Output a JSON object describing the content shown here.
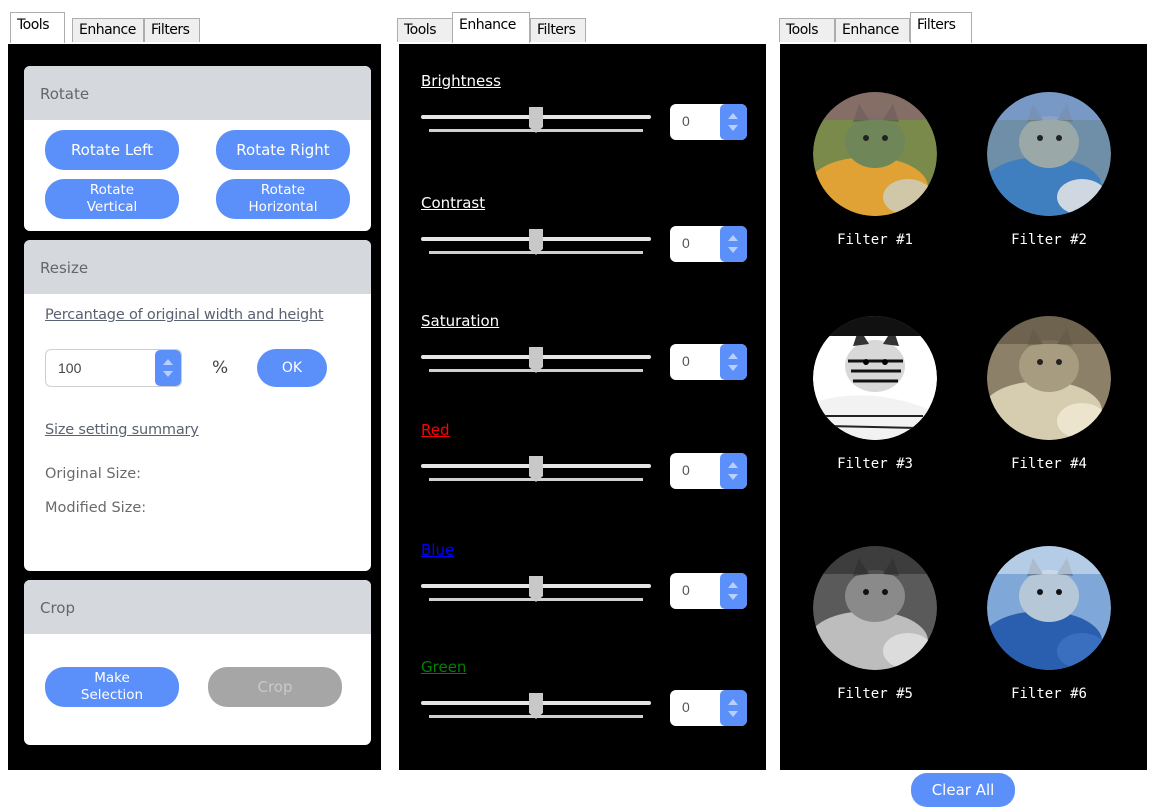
{
  "tools_panel": {
    "tabs": [
      "Tools",
      "Enhance",
      "Filters"
    ],
    "rotate": {
      "title": "Rotate",
      "rotate_left": "Rotate Left",
      "rotate_right": "Rotate Right",
      "rotate_vertical_1": "Rotate",
      "rotate_vertical_2": "Vertical",
      "rotate_horizontal_1": "Rotate",
      "rotate_horizontal_2": "Horizontal"
    },
    "resize": {
      "title": "Resize",
      "percentage_link": "Percantage of original width and height",
      "value": "100",
      "unit": "%",
      "ok": "OK",
      "summary_link": "Size setting summary",
      "original_size": "Original Size:",
      "modified_size": "Modified Size:"
    },
    "crop": {
      "title": "Crop",
      "make_selection_1": "Make",
      "make_selection_2": "Selection",
      "crop": "Crop"
    }
  },
  "enhance_panel": {
    "tabs": [
      "Tools",
      "Enhance",
      "Filters"
    ],
    "sliders": [
      {
        "label": "Brightness",
        "value": "0",
        "color": "#ffffff"
      },
      {
        "label": "Contrast",
        "value": "0",
        "color": "#ffffff"
      },
      {
        "label": "Saturation",
        "value": "0",
        "color": "#ffffff"
      },
      {
        "label": "Red",
        "value": "0",
        "color": "#ff0000"
      },
      {
        "label": "Blue",
        "value": "0",
        "color": "#0000ff"
      },
      {
        "label": "Green",
        "value": "0",
        "color": "#008000"
      }
    ]
  },
  "filters_panel": {
    "tabs": [
      "Tools",
      "Enhance",
      "Filters"
    ],
    "filters": [
      {
        "label": "Filter #1"
      },
      {
        "label": "Filter #2"
      },
      {
        "label": "Filter #3"
      },
      {
        "label": "Filter #4"
      },
      {
        "label": "Filter #5"
      },
      {
        "label": "Filter #6"
      }
    ],
    "clear_all": "Clear All"
  }
}
